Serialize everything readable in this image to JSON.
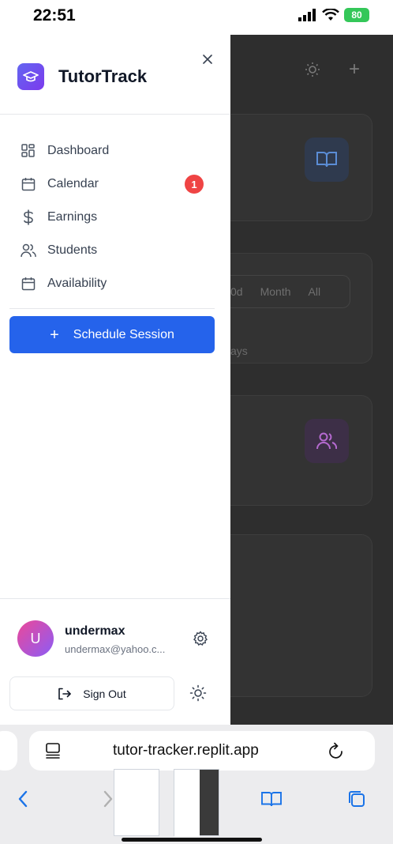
{
  "status_bar": {
    "time": "22:51",
    "battery": "80"
  },
  "sidebar": {
    "brand": "TutorTrack",
    "nav": [
      {
        "label": "Dashboard",
        "icon": "grid-icon"
      },
      {
        "label": "Calendar",
        "icon": "calendar-icon",
        "badge": "1"
      },
      {
        "label": "Earnings",
        "icon": "dollar-icon"
      },
      {
        "label": "Students",
        "icon": "users-icon"
      },
      {
        "label": "Availability",
        "icon": "calendar-icon"
      }
    ],
    "schedule_button": {
      "plus": "+",
      "label": "Schedule Session"
    },
    "user": {
      "initial": "U",
      "name": "undermax",
      "email": "undermax@yahoo.c..."
    },
    "sign_out_label": "Sign Out"
  },
  "background_app": {
    "segment_options": [
      "0d",
      "Month",
      "All"
    ],
    "days_text": "ays"
  },
  "browser": {
    "url": "tutor-tracker.replit.app"
  },
  "colors": {
    "primary": "#2563eb",
    "brand_gradient_start": "#6366f1",
    "brand_gradient_end": "#7c3aed",
    "badge": "#ef4444",
    "battery": "#34c759"
  }
}
